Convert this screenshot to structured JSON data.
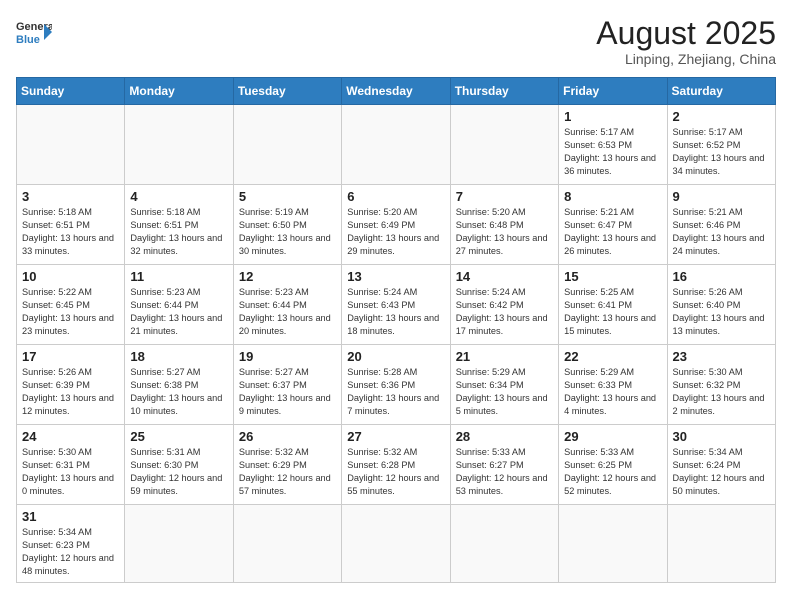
{
  "header": {
    "logo_general": "General",
    "logo_blue": "Blue",
    "month_year": "August 2025",
    "location": "Linping, Zhejiang, China"
  },
  "weekdays": [
    "Sunday",
    "Monday",
    "Tuesday",
    "Wednesday",
    "Thursday",
    "Friday",
    "Saturday"
  ],
  "weeks": [
    [
      {
        "day": "",
        "info": ""
      },
      {
        "day": "",
        "info": ""
      },
      {
        "day": "",
        "info": ""
      },
      {
        "day": "",
        "info": ""
      },
      {
        "day": "",
        "info": ""
      },
      {
        "day": "1",
        "info": "Sunrise: 5:17 AM\nSunset: 6:53 PM\nDaylight: 13 hours and 36 minutes."
      },
      {
        "day": "2",
        "info": "Sunrise: 5:17 AM\nSunset: 6:52 PM\nDaylight: 13 hours and 34 minutes."
      }
    ],
    [
      {
        "day": "3",
        "info": "Sunrise: 5:18 AM\nSunset: 6:51 PM\nDaylight: 13 hours and 33 minutes."
      },
      {
        "day": "4",
        "info": "Sunrise: 5:18 AM\nSunset: 6:51 PM\nDaylight: 13 hours and 32 minutes."
      },
      {
        "day": "5",
        "info": "Sunrise: 5:19 AM\nSunset: 6:50 PM\nDaylight: 13 hours and 30 minutes."
      },
      {
        "day": "6",
        "info": "Sunrise: 5:20 AM\nSunset: 6:49 PM\nDaylight: 13 hours and 29 minutes."
      },
      {
        "day": "7",
        "info": "Sunrise: 5:20 AM\nSunset: 6:48 PM\nDaylight: 13 hours and 27 minutes."
      },
      {
        "day": "8",
        "info": "Sunrise: 5:21 AM\nSunset: 6:47 PM\nDaylight: 13 hours and 26 minutes."
      },
      {
        "day": "9",
        "info": "Sunrise: 5:21 AM\nSunset: 6:46 PM\nDaylight: 13 hours and 24 minutes."
      }
    ],
    [
      {
        "day": "10",
        "info": "Sunrise: 5:22 AM\nSunset: 6:45 PM\nDaylight: 13 hours and 23 minutes."
      },
      {
        "day": "11",
        "info": "Sunrise: 5:23 AM\nSunset: 6:44 PM\nDaylight: 13 hours and 21 minutes."
      },
      {
        "day": "12",
        "info": "Sunrise: 5:23 AM\nSunset: 6:44 PM\nDaylight: 13 hours and 20 minutes."
      },
      {
        "day": "13",
        "info": "Sunrise: 5:24 AM\nSunset: 6:43 PM\nDaylight: 13 hours and 18 minutes."
      },
      {
        "day": "14",
        "info": "Sunrise: 5:24 AM\nSunset: 6:42 PM\nDaylight: 13 hours and 17 minutes."
      },
      {
        "day": "15",
        "info": "Sunrise: 5:25 AM\nSunset: 6:41 PM\nDaylight: 13 hours and 15 minutes."
      },
      {
        "day": "16",
        "info": "Sunrise: 5:26 AM\nSunset: 6:40 PM\nDaylight: 13 hours and 13 minutes."
      }
    ],
    [
      {
        "day": "17",
        "info": "Sunrise: 5:26 AM\nSunset: 6:39 PM\nDaylight: 13 hours and 12 minutes."
      },
      {
        "day": "18",
        "info": "Sunrise: 5:27 AM\nSunset: 6:38 PM\nDaylight: 13 hours and 10 minutes."
      },
      {
        "day": "19",
        "info": "Sunrise: 5:27 AM\nSunset: 6:37 PM\nDaylight: 13 hours and 9 minutes."
      },
      {
        "day": "20",
        "info": "Sunrise: 5:28 AM\nSunset: 6:36 PM\nDaylight: 13 hours and 7 minutes."
      },
      {
        "day": "21",
        "info": "Sunrise: 5:29 AM\nSunset: 6:34 PM\nDaylight: 13 hours and 5 minutes."
      },
      {
        "day": "22",
        "info": "Sunrise: 5:29 AM\nSunset: 6:33 PM\nDaylight: 13 hours and 4 minutes."
      },
      {
        "day": "23",
        "info": "Sunrise: 5:30 AM\nSunset: 6:32 PM\nDaylight: 13 hours and 2 minutes."
      }
    ],
    [
      {
        "day": "24",
        "info": "Sunrise: 5:30 AM\nSunset: 6:31 PM\nDaylight: 13 hours and 0 minutes."
      },
      {
        "day": "25",
        "info": "Sunrise: 5:31 AM\nSunset: 6:30 PM\nDaylight: 12 hours and 59 minutes."
      },
      {
        "day": "26",
        "info": "Sunrise: 5:32 AM\nSunset: 6:29 PM\nDaylight: 12 hours and 57 minutes."
      },
      {
        "day": "27",
        "info": "Sunrise: 5:32 AM\nSunset: 6:28 PM\nDaylight: 12 hours and 55 minutes."
      },
      {
        "day": "28",
        "info": "Sunrise: 5:33 AM\nSunset: 6:27 PM\nDaylight: 12 hours and 53 minutes."
      },
      {
        "day": "29",
        "info": "Sunrise: 5:33 AM\nSunset: 6:25 PM\nDaylight: 12 hours and 52 minutes."
      },
      {
        "day": "30",
        "info": "Sunrise: 5:34 AM\nSunset: 6:24 PM\nDaylight: 12 hours and 50 minutes."
      }
    ],
    [
      {
        "day": "31",
        "info": "Sunrise: 5:34 AM\nSunset: 6:23 PM\nDaylight: 12 hours and 48 minutes."
      },
      {
        "day": "",
        "info": ""
      },
      {
        "day": "",
        "info": ""
      },
      {
        "day": "",
        "info": ""
      },
      {
        "day": "",
        "info": ""
      },
      {
        "day": "",
        "info": ""
      },
      {
        "day": "",
        "info": ""
      }
    ]
  ]
}
